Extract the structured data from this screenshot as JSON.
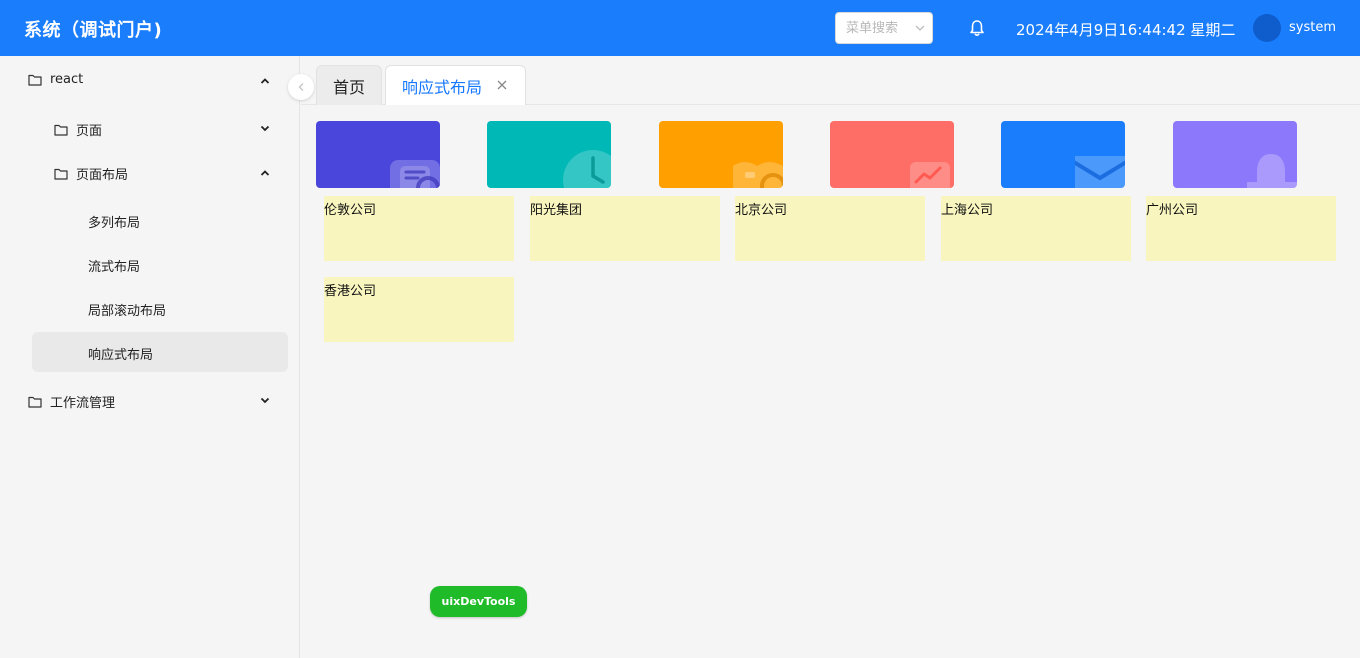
{
  "header": {
    "title": "系统（调试门户)",
    "search_placeholder": "菜单搜索",
    "datetime": "2024年4月9日16:44:42 星期二",
    "username": "system",
    "bg_color": "#1a7dfc"
  },
  "sidebar": {
    "items": [
      {
        "label": "react",
        "level": 0,
        "expanded": true
      },
      {
        "label": "页面",
        "level": 1,
        "expanded": false
      },
      {
        "label": "页面布局",
        "level": 1,
        "expanded": true
      },
      {
        "label": "多列布局",
        "level": 2
      },
      {
        "label": "流式布局",
        "level": 2
      },
      {
        "label": "局部滚动布局",
        "level": 2
      },
      {
        "label": "响应式布局",
        "level": 2,
        "active": true
      },
      {
        "label": "工作流管理",
        "level": 0,
        "expanded": false
      }
    ]
  },
  "tabs": [
    {
      "label": "首页",
      "active": false
    },
    {
      "label": "响应式布局",
      "active": true,
      "closable": true
    }
  ],
  "cards": [
    {
      "color": "#4b46db",
      "icon": "clock-document-icon"
    },
    {
      "color": "#00b8b6",
      "icon": "clock-icon"
    },
    {
      "color": "#ffa000",
      "icon": "book-icon"
    },
    {
      "color": "#ff6e66",
      "icon": "chart-icon"
    },
    {
      "color": "#1a7dfc",
      "icon": "mail-icon"
    },
    {
      "color": "#8c78fa",
      "icon": "bell-icon"
    }
  ],
  "companies": [
    "伦敦公司",
    "阳光集团",
    "北京公司",
    "上海公司",
    "广州公司",
    "香港公司"
  ],
  "devtools": {
    "label": "uixDevTools",
    "color": "#1fbb29"
  }
}
